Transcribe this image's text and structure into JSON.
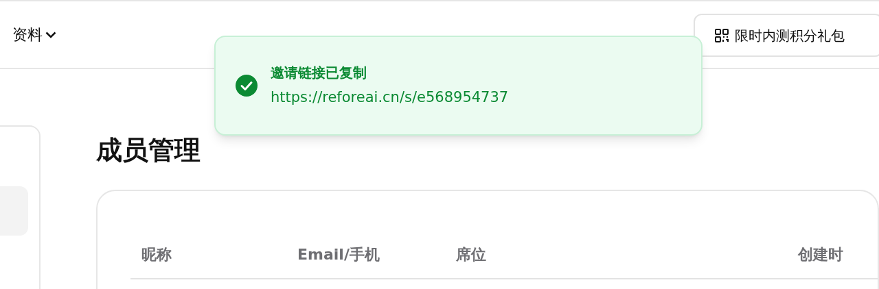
{
  "header": {
    "menu": {
      "label": "资料"
    },
    "promo_button": {
      "label": "限时内测积分礼包"
    }
  },
  "toast": {
    "title": "邀请链接已复制",
    "message": "https://reforeai.cn/s/e568954737"
  },
  "sidebar": {
    "items": [
      {
        "selected": true
      }
    ]
  },
  "page": {
    "title": "成员管理"
  },
  "table": {
    "columns": [
      {
        "label": "昵称"
      },
      {
        "label": "Email/手机"
      },
      {
        "label": "席位"
      },
      {
        "label": "创建时"
      }
    ]
  }
}
